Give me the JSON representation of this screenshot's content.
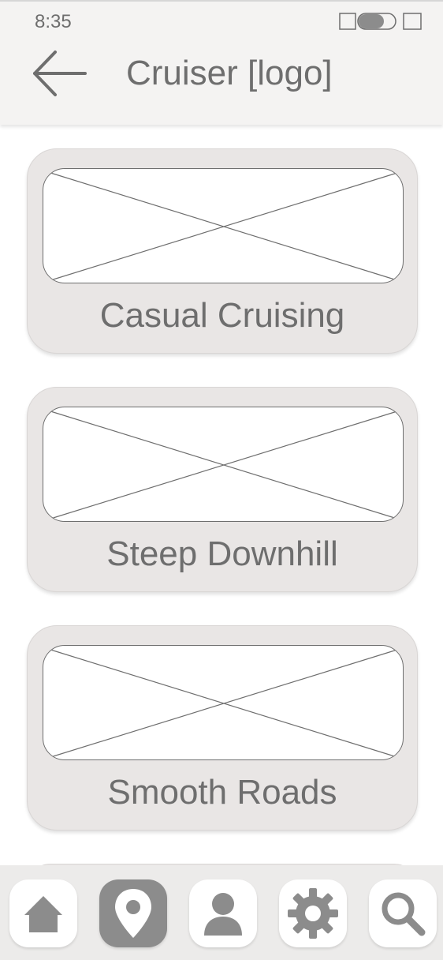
{
  "status_bar": {
    "time": "8:35"
  },
  "header": {
    "back_icon": "arrow-left-icon",
    "title": "Cruiser [logo]"
  },
  "cards": [
    {
      "label": "Casual Cruising",
      "image": "image-placeholder"
    },
    {
      "label": "Steep Downhill",
      "image": "image-placeholder"
    },
    {
      "label": "Smooth Roads",
      "image": "image-placeholder"
    }
  ],
  "bottom_nav": {
    "active": "map-pin",
    "items": [
      "home-icon",
      "map-pin-icon",
      "profile-icon",
      "settings-gear-icon",
      "search-icon"
    ]
  },
  "colors": {
    "header_bg": "#f4f3f2",
    "card_bg": "#e9e6e5",
    "text": "#6e6e6e",
    "active_nav": "#8c8c8c",
    "nav_bg": "#ecebea"
  }
}
